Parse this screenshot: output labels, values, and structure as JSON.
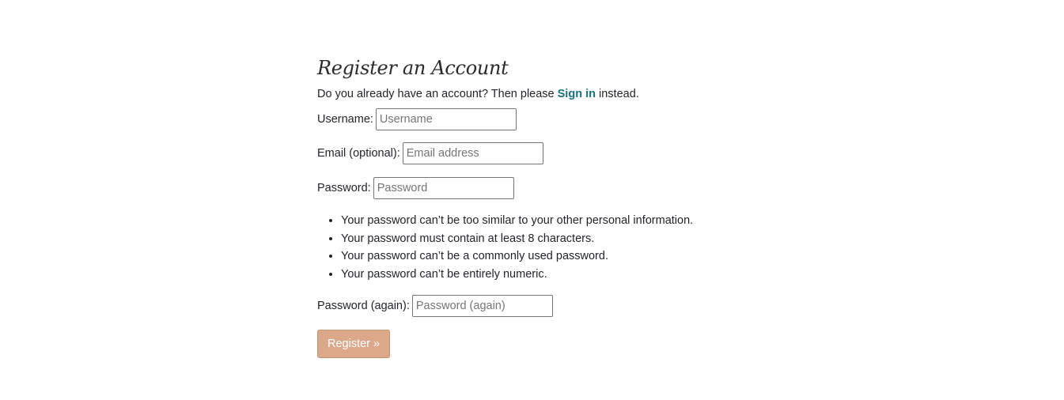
{
  "page": {
    "title": "Register an Account"
  },
  "intro": {
    "prefix": "Do you already have an account? Then please ",
    "link_label": "Sign in",
    "suffix": " instead."
  },
  "form": {
    "username": {
      "label": "Username:",
      "placeholder": "Username",
      "value": ""
    },
    "email": {
      "label": "Email (optional):",
      "placeholder": "Email address",
      "value": ""
    },
    "password": {
      "label": "Password:",
      "placeholder": "Password",
      "value": ""
    },
    "password_help": [
      "Your password can’t be too similar to your other personal information.",
      "Your password must contain at least 8 characters.",
      "Your password can’t be a commonly used password.",
      "Your password can’t be entirely numeric."
    ],
    "password2": {
      "label": "Password (again):",
      "placeholder": "Password (again)",
      "value": ""
    },
    "submit_label": "Register »"
  },
  "colors": {
    "link": "#17707f",
    "button_bg": "#dba88a",
    "button_text": "#ffffff"
  }
}
